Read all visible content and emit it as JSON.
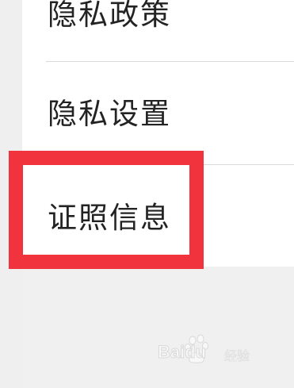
{
  "menu": {
    "items": [
      {
        "label": "隐私政策"
      },
      {
        "label": "隐私设置"
      },
      {
        "label": "证照信息"
      }
    ]
  },
  "watermark": {
    "brand": "Baidu",
    "product": "经验"
  },
  "colors": {
    "highlight": "#f0333c",
    "card_background": "#ffffff",
    "page_background": "#f0f0f0",
    "divider": "#d9d9d9",
    "text": "#232323"
  }
}
